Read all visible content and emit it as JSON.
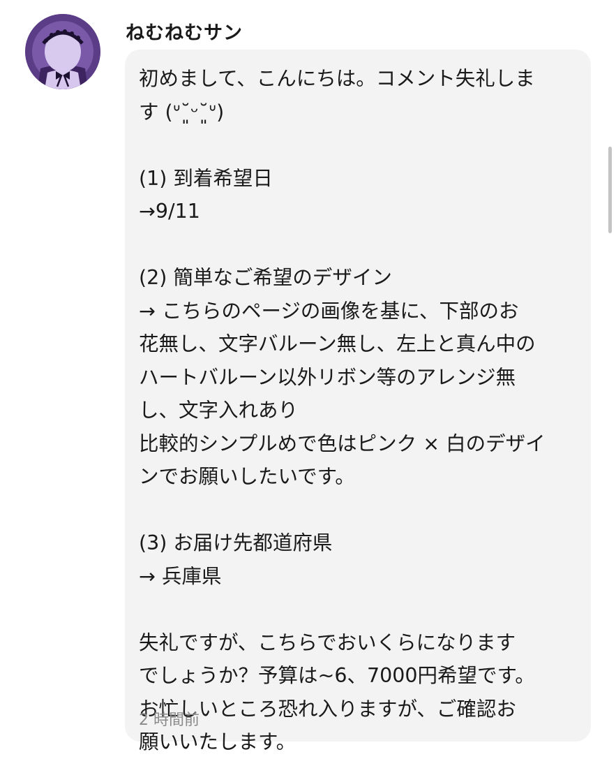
{
  "comment": {
    "author": "ねむねむサン",
    "lines": [
      "初めまして、こんにちは。コメント失礼しま",
      "す (ᐡ˘͈ᵕ˘͈ᐡ)",
      "",
      "(1) 到着希望日",
      "→9/11",
      "",
      "(2) 簡単なご希望のデザイン",
      "→ こちらのページの画像を基に、下部のお",
      "花無し、文字バルーン無し、左上と真ん中の",
      "ハートバルーン以外リボン等のアレンジ無",
      "し、文字入れあり",
      "比較的シンプルめで色はピンク × 白のデザイ",
      "ンでお願いしたいです。",
      "",
      "(3) お届け先都道府県",
      "→ 兵庫県",
      "",
      "失礼ですが、こちらでおいくらになります",
      "でしょうか？予算は~6、7000円希望です。",
      "お忙しいところ恐れ入りますが、ご確認お",
      "願いいたします。"
    ],
    "timestamp": "2 時間前"
  },
  "colors": {
    "bubble_background": "#f3f3f3",
    "timestamp_text": "#8a8a8a",
    "avatar_background": "#5a3a82"
  },
  "icons": {
    "avatar": "avatar-girl-with-bow-icon"
  }
}
